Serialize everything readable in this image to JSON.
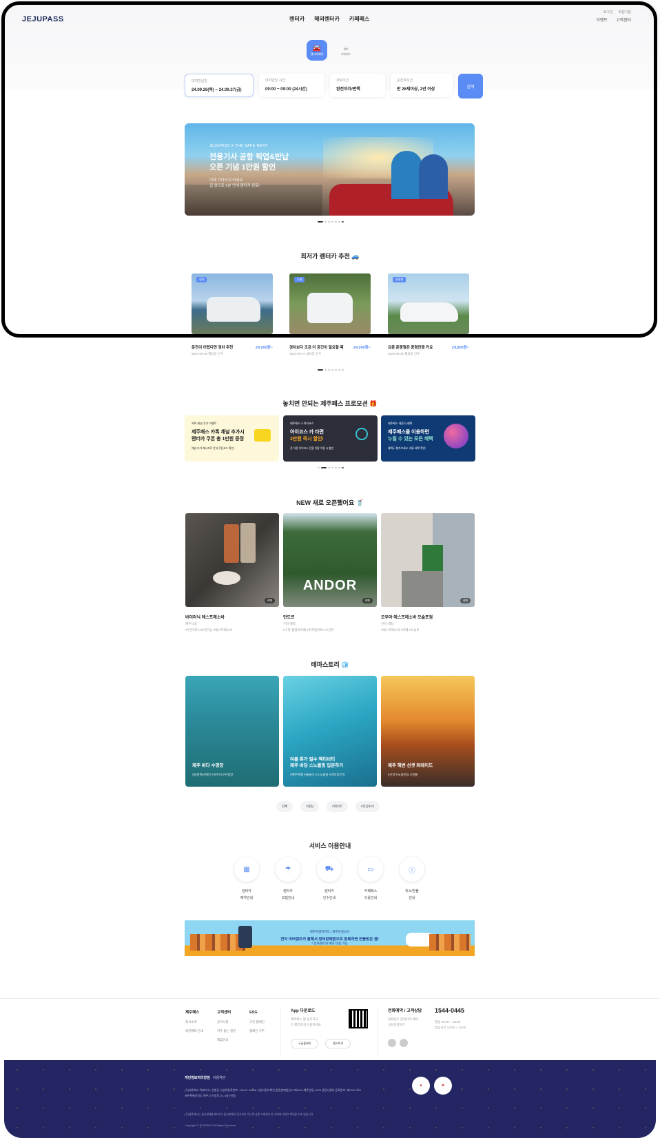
{
  "header": {
    "logo": "JEJUPASS",
    "nav": [
      "렌터카",
      "해외렌터카",
      "카페패스"
    ],
    "util_top": [
      "로그인",
      "회원가입"
    ],
    "util_bottom": [
      "이벤트",
      "고객센터"
    ]
  },
  "tabs": [
    {
      "label": "렌터카예약"
    },
    {
      "label": "카페패스"
    }
  ],
  "search": {
    "date": {
      "label": "대여반납일",
      "value": "24.09.26(목) ~ 24.09.27(금)"
    },
    "time": {
      "label": "대여반납 시간",
      "value": "09:00 ~ 09:00 (24시간)"
    },
    "insurance": {
      "label": "차량조건",
      "value": "완전자차/면책"
    },
    "driver": {
      "label": "운전자조건",
      "value": "만 26세이상, 2년 이상"
    },
    "button": "검색"
  },
  "banner": {
    "sub": "JEJUPASS X THE SAFE RENT",
    "title1": "전용기사 공항 픽업&반납",
    "title2": "오픈 기념 1만원 할인",
    "desc1": "이제 기다리지 마세요",
    "desc2": "집 앞으로 5분 안에 렌터카 완료!"
  },
  "section_cars": {
    "title": "최저가 렌터카 추천 🚙",
    "items": [
      {
        "tag": "경차",
        "name": "운전이 어렵다면 경차 추천",
        "price": "24,000원~",
        "date": "2024-09-30 월요일 인수"
      },
      {
        "tag": "소형",
        "name": "경차보다 조금 더 공간이 필요할 때",
        "price": "24,000원~",
        "date": "2024-09-27 금요일 인수"
      },
      {
        "tag": "준중형",
        "name": "요즘 준중형은 중형만큼 커요",
        "price": "29,800원~",
        "date": "2024-09-30 월요일 인수"
      }
    ]
  },
  "section_promo": {
    "title": "놓치면 안되는 제주패스 프로모션 🎁",
    "items": [
      {
        "sub": "카톡 채널 추가 이벤트",
        "title1": "제주패스 카톡 채널 추가시",
        "title2": "렌터카 쿠폰 총 1만원 증정",
        "foot": "채널 추가 메시지로 안내 쿠폰코드 확인!"
      },
      {
        "sub": "제주패스 X 아이코스",
        "title1": "아이코스 카 타면",
        "title2": "2만원 즉시 할인!",
        "foot": "전 차량 아이코스 전용 차량 이용 시 할인"
      },
      {
        "sub": "제주패스 제휴사 혜택",
        "title1": "제주패스를 이용하면",
        "title2": "누릴 수 있는 모든 혜택",
        "foot": "혜택도 챙겨보세요, 제휴 혜택 확인!"
      }
    ]
  },
  "section_new": {
    "title": "NEW 새로 오픈했어요 🥤",
    "items": [
      {
        "name": "바이러닉 에스프레소바",
        "cat": "제주시내",
        "tags": "#무인커피 #보관가능 #에스프레소바",
        "badge": "카페"
      },
      {
        "name": "안도르",
        "cat": "구좌·월정",
        "tags": "#구좌·월정리카페 #루프탑카페 #오션뷰",
        "badge": "카페"
      },
      {
        "name": "오우야 에스프레소바 오술포점",
        "cat": "안덕·대정",
        "tags": "#에스프레소바 #카페 #오술포",
        "badge": "카페"
      }
    ]
  },
  "section_theme": {
    "title": "테마스토리 🧊",
    "items": [
      {
        "title1": "제주 바다 수영장",
        "title2": "",
        "tags": "#용담해 #해안 #사우나 #수영장"
      },
      {
        "title1": "여름 휴가 필수 액티비티",
        "title2": "제주 바당 스노클링 입문하기",
        "tags": "#제주여행 #물놀이 #스노클링 #바다포인트"
      },
      {
        "title1": "제주 해변 선셋 퍼레이드",
        "title2": "",
        "tags": "#선셋 #노을명소 #일몰"
      }
    ],
    "chips": [
      "전체",
      "#힐링",
      "#데이트",
      "#맛집투어"
    ]
  },
  "section_service": {
    "title": "서비스 이용안내",
    "items": [
      {
        "line1": "렌터카",
        "line2": "예약안내"
      },
      {
        "line1": "렌터카",
        "line2": "보험안내"
      },
      {
        "line1": "렌터카",
        "line2": "인수안내"
      },
      {
        "line1": "카페패스",
        "line2": "이용안내"
      },
      {
        "line1": "취소/환불",
        "line2": "안내"
      }
    ]
  },
  "ad": {
    "sub": "제주특별자치도 | 제주관광공사",
    "title": "전자 미터렌트카 통해서 정비판매원으로 등록하면 연봉받은 셈!",
    "desc": "* 전자렌트카 예약 이용 가능"
  },
  "footer": {
    "cols": [
      {
        "title": "제주패스",
        "items": [
          "회사소개",
          "회원혜택 안내"
        ]
      },
      {
        "title": "고객센터",
        "items": [
          "공지사항",
          "자주 묻는 질문",
          "제휴문의"
        ]
      },
      {
        "title": "ESG",
        "items": [
          "그린 캠페인",
          "캠페인 기부"
        ]
      }
    ],
    "app": {
      "title": "App 다운로드",
      "desc1": "제주패스 앱 설치하고",
      "desc2": "더 편리하게 이용하세요",
      "btn1": "구글플레이",
      "btn2": "앱스토어"
    },
    "cs": {
      "title": "전화예약 / 고객상담",
      "desc1": "대표번호 전화하여 예약",
      "desc2": "상담신청하기",
      "phone": "1544-0445",
      "hours1": "평일 09:00 ~ 18:00",
      "hours2": "점심시간 12:00 ~ 13:00"
    },
    "links": [
      "개인정보처리방침",
      "이용약관"
    ],
    "info1": "(주)제주패스 대표이사: 윤형준  사업자등록번호: 105-87-78566  사업자정보확인  통신판매업신고 제2019-제주연동-0228  관광사업자 등록번호: 제2021-000",
    "info2": "제주특별자치도 제주시 신광로 25, 4층 (연동)",
    "legal": "(주)제주패스는 통신판매중개자로서 통신판매의 당사자가 아니며 상품 거래정보 및 거래에 대하여 책임을 지지 않습니다.",
    "copy": "Copyright © JEJUPASS All Rights Reserved."
  },
  "colors": {
    "accent": "#5b8cf5",
    "footer_bg": "#232663"
  }
}
